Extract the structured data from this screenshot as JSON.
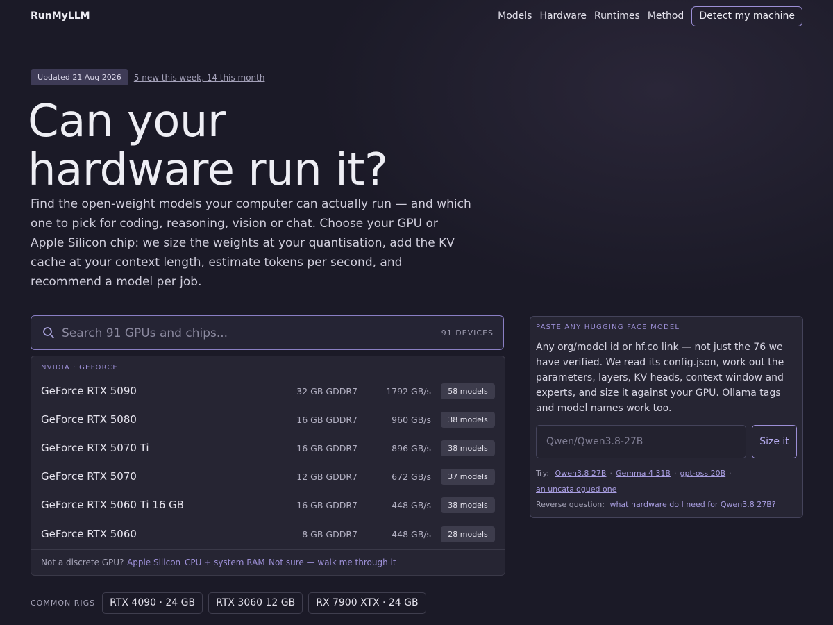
{
  "nav": {
    "brand": "RunMyLLM",
    "links": [
      "Models",
      "Hardware",
      "Runtimes",
      "Method"
    ],
    "cta": "Detect my machine"
  },
  "hero": {
    "updated_badge": "Updated 21 Aug 2026",
    "new_link": "5 new this week, 14 this month",
    "headline_line1": "Can your",
    "headline_line2": "hardware run it?",
    "lede": "Find the open-weight models your computer can actually run — and which one to pick for coding, reasoning, vision or chat. Choose your GPU or Apple Silicon chip: we size the weights at your quantisation, add the KV cache at your context length, estimate tokens per second, and recommend a model per job."
  },
  "search": {
    "placeholder": "Search 91 GPUs and chips...",
    "count": "91 DEVICES",
    "icon": "search-icon"
  },
  "dropdown": {
    "group_label": "NVIDIA · GEFORCE",
    "rows": [
      {
        "name": "GeForce RTX 5090",
        "memory": "32 GB GDDR7",
        "bandwidth": "1792 GB/s",
        "models": "58 models"
      },
      {
        "name": "GeForce RTX 5080",
        "memory": "16 GB GDDR7",
        "bandwidth": "960 GB/s",
        "models": "38 models"
      },
      {
        "name": "GeForce RTX 5070 Ti",
        "memory": "16 GB GDDR7",
        "bandwidth": "896 GB/s",
        "models": "38 models"
      },
      {
        "name": "GeForce RTX 5070",
        "memory": "12 GB GDDR7",
        "bandwidth": "672 GB/s",
        "models": "37 models"
      },
      {
        "name": "GeForce RTX 5060 Ti 16 GB",
        "memory": "16 GB GDDR7",
        "bandwidth": "448 GB/s",
        "models": "38 models"
      },
      {
        "name": "GeForce RTX 5060",
        "memory": "8 GB GDDR7",
        "bandwidth": "448 GB/s",
        "models": "28 models"
      }
    ],
    "footer_question": "Not a discrete GPU?",
    "footer_links": [
      "Apple Silicon",
      "CPU + system RAM",
      "Not sure — walk me through it"
    ]
  },
  "rigs": {
    "label": "COMMON RIGS",
    "items": [
      "RTX 4090 · 24 GB",
      "RTX 3060 12 GB",
      "RX 7900 XTX · 24 GB"
    ]
  },
  "hf_panel": {
    "label": "PASTE ANY HUGGING FACE MODEL",
    "description": "Any org/model id or hf.co link — not just the 76 we have verified. We read its config.json, work out the parameters, layers, KV heads, context window and experts, and size it against your GPU. Ollama tags and model names work too.",
    "input_placeholder": "Qwen/Qwen3.8-27B",
    "button": "Size it",
    "try_label": "Try:",
    "try_links": [
      "Qwen3.8 27B",
      "Gemma 4 31B",
      "gpt-oss 20B",
      "an uncatalogued one"
    ],
    "reverse_label": "Reverse question:",
    "reverse_link": "what hardware do I need for Qwen3.8 27B?"
  },
  "colors": {
    "background": "#1b1a27",
    "accent": "#9c8fd6",
    "panel": "#262533"
  }
}
